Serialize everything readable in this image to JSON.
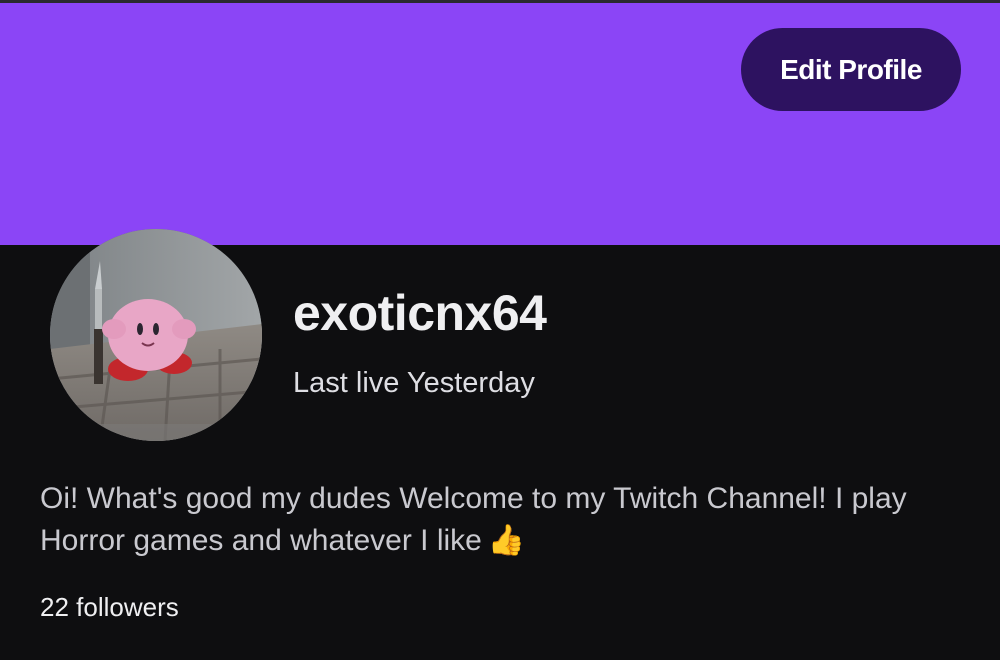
{
  "profile": {
    "edit_button_label": "Edit Profile",
    "username": "exoticnx64",
    "last_live": "Last live Yesterday",
    "bio": "Oi! What's good my dudes Welcome to my Twitch Channel! I play Horror games and whatever I like",
    "bio_emoji": "👍",
    "followers": "22 followers",
    "avatar_description_icon": "kirby-with-knife-avatar"
  },
  "colors": {
    "banner": "#8b45f6",
    "background": "#0e0e10",
    "edit_button_bg": "#2d1260"
  }
}
